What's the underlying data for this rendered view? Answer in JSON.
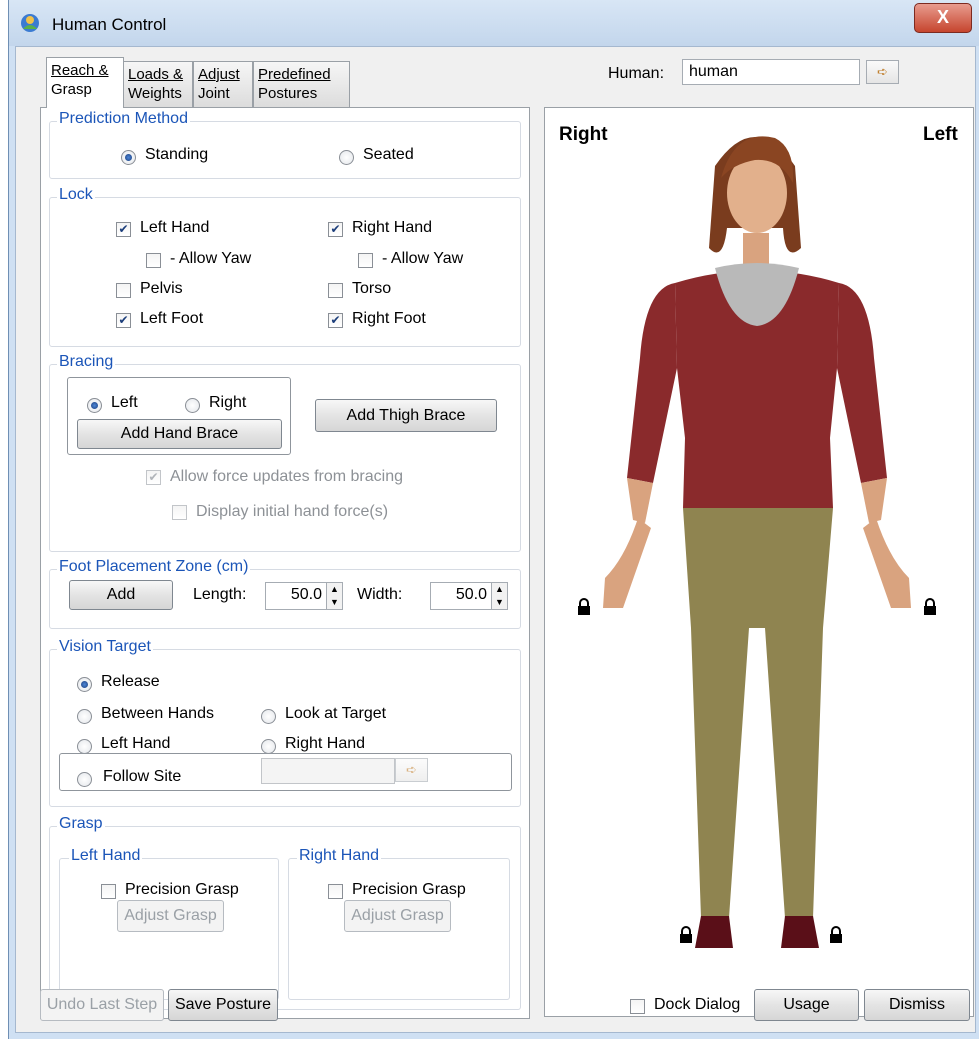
{
  "window": {
    "title": "Human Control",
    "close_glyph": "X"
  },
  "tabs": [
    {
      "line1": "Reach &",
      "line2": "Grasp"
    },
    {
      "line1": "Loads &",
      "line2": "Weights"
    },
    {
      "line1": "Adjust",
      "line2": "Joint"
    },
    {
      "line1": "Predefined",
      "line2": "Postures"
    }
  ],
  "human": {
    "label": "Human:",
    "value": "human"
  },
  "prediction": {
    "title": "Prediction Method",
    "standing": "Standing",
    "seated": "Seated",
    "selected": "Standing"
  },
  "lock": {
    "title": "Lock",
    "left_hand": "Left Hand",
    "left_hand_checked": true,
    "left_allow_yaw": "- Allow Yaw",
    "left_allow_yaw_checked": false,
    "right_hand": "Right Hand",
    "right_hand_checked": true,
    "right_allow_yaw": "- Allow Yaw",
    "right_allow_yaw_checked": false,
    "pelvis": "Pelvis",
    "pelvis_checked": false,
    "torso": "Torso",
    "torso_checked": false,
    "left_foot": "Left Foot",
    "left_foot_checked": true,
    "right_foot": "Right Foot",
    "right_foot_checked": true
  },
  "bracing": {
    "title": "Bracing",
    "left": "Left",
    "right": "Right",
    "selected": "Left",
    "add_hand_brace": "Add Hand Brace",
    "add_thigh_brace": "Add Thigh Brace",
    "allow_force_updates": "Allow force updates from bracing",
    "display_initial_force": "Display initial hand force(s)"
  },
  "foot_zone": {
    "title": "Foot Placement Zone (cm)",
    "add": "Add",
    "length_label": "Length:",
    "length": "50.0",
    "width_label": "Width:",
    "width": "50.0"
  },
  "vision": {
    "title": "Vision Target",
    "release": "Release",
    "between_hands": "Between Hands",
    "look_at_target": "Look at Target",
    "left_hand": "Left Hand",
    "right_hand": "Right Hand",
    "follow_site": "Follow Site",
    "selected": "Release"
  },
  "grasp": {
    "title": "Grasp",
    "left_title": "Left Hand",
    "right_title": "Right Hand",
    "precision": "Precision Grasp",
    "adjust": "Adjust Grasp"
  },
  "viewport": {
    "right_label": "Right",
    "left_label": "Left"
  },
  "footer": {
    "undo": "Undo Last Step",
    "save": "Save Posture",
    "dock": "Dock Dialog",
    "usage": "Usage",
    "dismiss": "Dismiss"
  },
  "colors": {
    "shirt": "#8a2a2c",
    "pants": "#8f8450",
    "skin": "#d9a37f",
    "hair": "#7a3c1e",
    "accent": "#1b55b8"
  }
}
